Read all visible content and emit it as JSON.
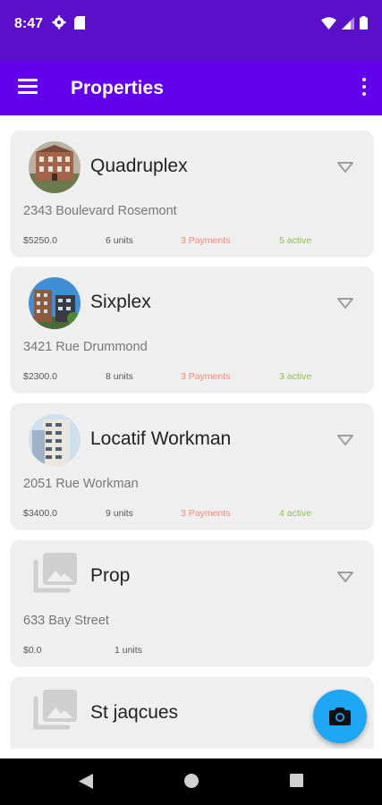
{
  "status_bar": {
    "time": "8:47"
  },
  "app_bar": {
    "title": "Properties"
  },
  "properties": [
    {
      "name": "Quadruplex",
      "address": "2343 Boulevard Rosemont",
      "price": "$5250.0",
      "units": "6 units",
      "payments": "3 Payments",
      "active": "5 active",
      "image": "building-photo"
    },
    {
      "name": "Sixplex",
      "address": "3421 Rue Drummond",
      "price": "$2300.0",
      "units": "8 units",
      "payments": "3 Payments",
      "active": "3 active",
      "image": "building-photo"
    },
    {
      "name": "Locatif Workman",
      "address": "2051 Rue Workman",
      "price": "$3400.0",
      "units": "9 units",
      "payments": "3 Payments",
      "active": "4 active",
      "image": "building-photo"
    },
    {
      "name": "Prop",
      "address": "633 Bay Street",
      "price": "$0.0",
      "units": "1 units",
      "image": "image-placeholder-icon"
    },
    {
      "name": "St jaqcues",
      "image": "image-placeholder-icon"
    }
  ],
  "colors": {
    "status_bar": "#5a0fc8",
    "app_bar": "#6200ee",
    "fab": "#1ea7f4",
    "payments": "#f28b82",
    "active": "#8bc34a"
  },
  "fab": {
    "icon": "camera-icon"
  }
}
